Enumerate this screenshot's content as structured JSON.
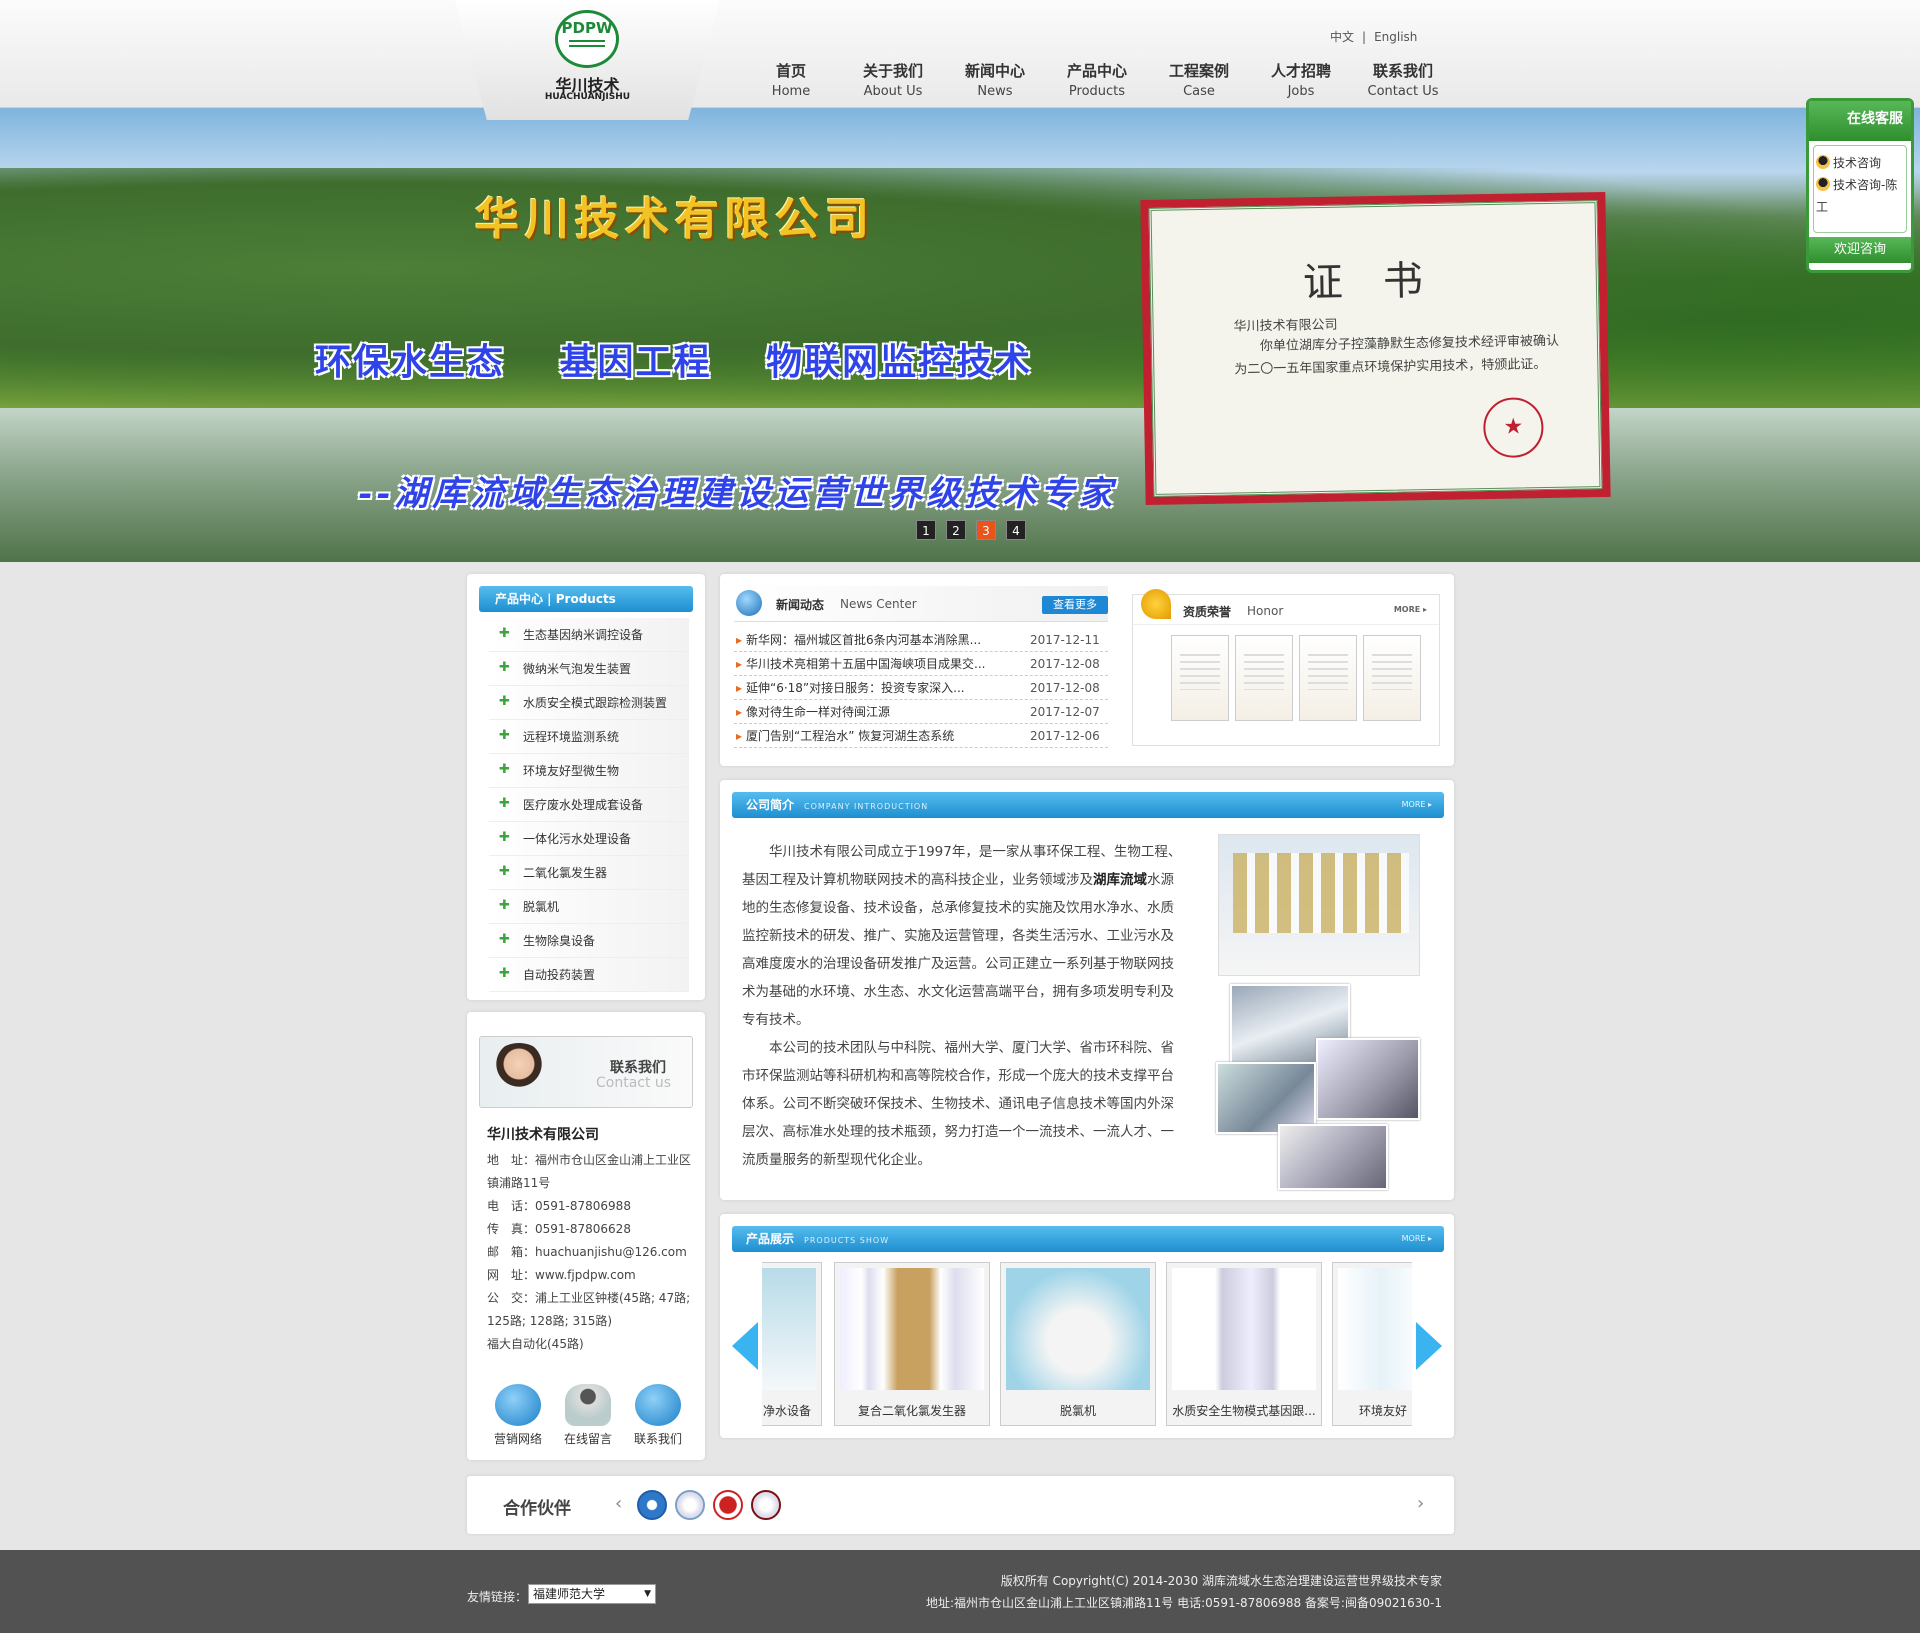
{
  "header": {
    "logo_mark": "PDPW",
    "logo_cn": "华川技术",
    "logo_en": "HUACHUANJISHU",
    "lang": [
      "中文",
      "English"
    ],
    "lang_sep": "|",
    "nav": [
      {
        "cn": "首页",
        "en": "Home"
      },
      {
        "cn": "关于我们",
        "en": "About Us"
      },
      {
        "cn": "新闻中心",
        "en": "News"
      },
      {
        "cn": "产品中心",
        "en": "Products"
      },
      {
        "cn": "工程案例",
        "en": "Case"
      },
      {
        "cn": "人才招聘",
        "en": "Jobs"
      },
      {
        "cn": "联系我们",
        "en": "Contact Us"
      }
    ]
  },
  "banner": {
    "title": "华川技术有限公司",
    "subtitle": "环保水生态 基因工程 物联网监控技术",
    "slogan": "--湖库流域生态治理建设运营世界级技术专家",
    "cert": {
      "title": "证书",
      "company": "华川技术有限公司",
      "body": "你单位湖库分子控藻静默生态修复技术经评审被确认为二〇一五年国家重点环境保护实用技术，特颁此证。",
      "seal": "★"
    },
    "pages": [
      "1",
      "2",
      "3",
      "4"
    ],
    "active_page": "3"
  },
  "products_menu": {
    "title": "产品中心 | Products",
    "items": [
      "生态基因纳米调控设备",
      "微纳米气泡发生装置",
      "水质安全模式跟踪检测装置",
      "远程环境监测系统",
      "环境友好型微生物",
      "医疗废水处理成套设备",
      "一体化污水处理设备",
      "二氧化氯发生器",
      "脱氯机",
      "生物除臭设备",
      "自动投药装置"
    ]
  },
  "contact": {
    "banner_cn": "联系我们",
    "banner_en": "Contact us",
    "company": "华川技术有限公司",
    "lines": [
      "地　址：福州市仓山区金山浦上工业区镇浦路11号",
      "电　话：0591-87806988",
      "传　真：0591-87806628",
      "邮　箱：huachuanjishu@126.com",
      "网　址：www.fjpdpw.com",
      "公　交：浦上工业区钟楼(45路; 47路; 125路; 128路; 315路)",
      "福大自动化(45路)"
    ],
    "icons": [
      "营销网络",
      "在线留言",
      "联系我们"
    ]
  },
  "news": {
    "title": "新闻动态",
    "title_en": "News Center",
    "more": "查看更多",
    "items": [
      {
        "title": "新华网：福州城区首批6条内河基本消除黑...",
        "date": "2017-12-11"
      },
      {
        "title": "华川技术亮相第十五届中国海峡项目成果交...",
        "date": "2017-12-08"
      },
      {
        "title": "延伸“6·18”对接日服务：投资专家深入...",
        "date": "2017-12-08"
      },
      {
        "title": "像对待生命一样对待闽江源",
        "date": "2017-12-07"
      },
      {
        "title": "厦门告别“工程治水” 恢复河湖生态系统",
        "date": "2017-12-06"
      }
    ]
  },
  "honor": {
    "title": "资质荣誉",
    "title_en": "Honor",
    "more": "MORE ▸"
  },
  "intro": {
    "title": "公司简介",
    "title_en": "COMPANY INTRODUCTION",
    "more": "MORE ▸",
    "p1_a": "华川技术有限公司成立于1997年，是一家从事环保工程、生物工程、基因工程及计算机物联网技术的高科技企业，业务领域涉及",
    "p1_b": "湖库流域",
    "p1_c": "水源地的生态修复设备、技术设备，总承修复技术的实施及饮用水净水、水质监控新技术的研发、推广、实施及运营管理，各类生活污水、工业污水及高难度废水的治理设备研发推广及运营。公司正建立一系列基于物联网技术为基础的水环境、水生态、水文化运营高端平台，拥有多项发明专利及专有技术。",
    "p2": "本公司的技术团队与中科院、福州大学、厦门大学、省市环科院、省市环保监测站等科研机构和高等院校合作，形成一个庞大的技术支撑平台体系。公司不断突破环保技术、生物技术、通讯电子信息技术等国内外深层次、高标准水处理的技术瓶颈，努力打造一个一流技术、一流人才、一流质量服务的新型现代化企业。"
  },
  "product_show": {
    "title": "产品展示",
    "title_en": "PRODUCTS SHOW",
    "more": "MORE ▸",
    "items": [
      "净水设备",
      "复合二氧化氯发生器",
      "脱氯机",
      "水质安全生物模式基因跟...",
      "环境友好"
    ]
  },
  "partners": {
    "title": "合作伙伴",
    "prev": "‹",
    "next": "›"
  },
  "footer": {
    "links_label": "友情链接：",
    "links_selected": "福建师范大学",
    "copyright": "版权所有 Copyright(C) 2014-2030 湖库流域水生态治理建设运营世界级技术专家",
    "address": "地址:福州市仓山区金山浦上工业区镇浦路11号 电话:0591-87806988 备案号:闽备09021630-1"
  },
  "service": {
    "title": "在线客服",
    "items": [
      "技术咨询",
      "技术咨询-陈工"
    ],
    "footer": "欢迎咨询"
  }
}
